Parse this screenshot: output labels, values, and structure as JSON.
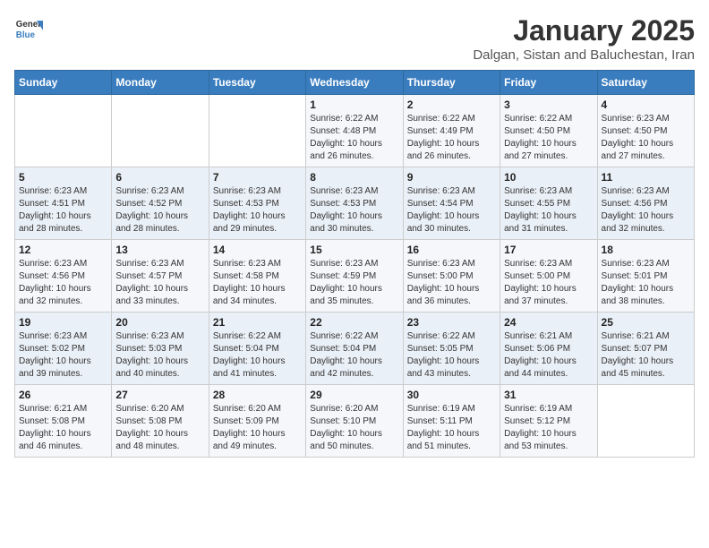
{
  "header": {
    "logo_line1": "General",
    "logo_line2": "Blue",
    "title": "January 2025",
    "subtitle": "Dalgan, Sistan and Baluchestan, Iran"
  },
  "days_of_week": [
    "Sunday",
    "Monday",
    "Tuesday",
    "Wednesday",
    "Thursday",
    "Friday",
    "Saturday"
  ],
  "weeks": [
    [
      {
        "day": "",
        "info": ""
      },
      {
        "day": "",
        "info": ""
      },
      {
        "day": "",
        "info": ""
      },
      {
        "day": "1",
        "info": "Sunrise: 6:22 AM\nSunset: 4:48 PM\nDaylight: 10 hours and 26 minutes."
      },
      {
        "day": "2",
        "info": "Sunrise: 6:22 AM\nSunset: 4:49 PM\nDaylight: 10 hours and 26 minutes."
      },
      {
        "day": "3",
        "info": "Sunrise: 6:22 AM\nSunset: 4:50 PM\nDaylight: 10 hours and 27 minutes."
      },
      {
        "day": "4",
        "info": "Sunrise: 6:23 AM\nSunset: 4:50 PM\nDaylight: 10 hours and 27 minutes."
      }
    ],
    [
      {
        "day": "5",
        "info": "Sunrise: 6:23 AM\nSunset: 4:51 PM\nDaylight: 10 hours and 28 minutes."
      },
      {
        "day": "6",
        "info": "Sunrise: 6:23 AM\nSunset: 4:52 PM\nDaylight: 10 hours and 28 minutes."
      },
      {
        "day": "7",
        "info": "Sunrise: 6:23 AM\nSunset: 4:53 PM\nDaylight: 10 hours and 29 minutes."
      },
      {
        "day": "8",
        "info": "Sunrise: 6:23 AM\nSunset: 4:53 PM\nDaylight: 10 hours and 30 minutes."
      },
      {
        "day": "9",
        "info": "Sunrise: 6:23 AM\nSunset: 4:54 PM\nDaylight: 10 hours and 30 minutes."
      },
      {
        "day": "10",
        "info": "Sunrise: 6:23 AM\nSunset: 4:55 PM\nDaylight: 10 hours and 31 minutes."
      },
      {
        "day": "11",
        "info": "Sunrise: 6:23 AM\nSunset: 4:56 PM\nDaylight: 10 hours and 32 minutes."
      }
    ],
    [
      {
        "day": "12",
        "info": "Sunrise: 6:23 AM\nSunset: 4:56 PM\nDaylight: 10 hours and 32 minutes."
      },
      {
        "day": "13",
        "info": "Sunrise: 6:23 AM\nSunset: 4:57 PM\nDaylight: 10 hours and 33 minutes."
      },
      {
        "day": "14",
        "info": "Sunrise: 6:23 AM\nSunset: 4:58 PM\nDaylight: 10 hours and 34 minutes."
      },
      {
        "day": "15",
        "info": "Sunrise: 6:23 AM\nSunset: 4:59 PM\nDaylight: 10 hours and 35 minutes."
      },
      {
        "day": "16",
        "info": "Sunrise: 6:23 AM\nSunset: 5:00 PM\nDaylight: 10 hours and 36 minutes."
      },
      {
        "day": "17",
        "info": "Sunrise: 6:23 AM\nSunset: 5:00 PM\nDaylight: 10 hours and 37 minutes."
      },
      {
        "day": "18",
        "info": "Sunrise: 6:23 AM\nSunset: 5:01 PM\nDaylight: 10 hours and 38 minutes."
      }
    ],
    [
      {
        "day": "19",
        "info": "Sunrise: 6:23 AM\nSunset: 5:02 PM\nDaylight: 10 hours and 39 minutes."
      },
      {
        "day": "20",
        "info": "Sunrise: 6:23 AM\nSunset: 5:03 PM\nDaylight: 10 hours and 40 minutes."
      },
      {
        "day": "21",
        "info": "Sunrise: 6:22 AM\nSunset: 5:04 PM\nDaylight: 10 hours and 41 minutes."
      },
      {
        "day": "22",
        "info": "Sunrise: 6:22 AM\nSunset: 5:04 PM\nDaylight: 10 hours and 42 minutes."
      },
      {
        "day": "23",
        "info": "Sunrise: 6:22 AM\nSunset: 5:05 PM\nDaylight: 10 hours and 43 minutes."
      },
      {
        "day": "24",
        "info": "Sunrise: 6:21 AM\nSunset: 5:06 PM\nDaylight: 10 hours and 44 minutes."
      },
      {
        "day": "25",
        "info": "Sunrise: 6:21 AM\nSunset: 5:07 PM\nDaylight: 10 hours and 45 minutes."
      }
    ],
    [
      {
        "day": "26",
        "info": "Sunrise: 6:21 AM\nSunset: 5:08 PM\nDaylight: 10 hours and 46 minutes."
      },
      {
        "day": "27",
        "info": "Sunrise: 6:20 AM\nSunset: 5:08 PM\nDaylight: 10 hours and 48 minutes."
      },
      {
        "day": "28",
        "info": "Sunrise: 6:20 AM\nSunset: 5:09 PM\nDaylight: 10 hours and 49 minutes."
      },
      {
        "day": "29",
        "info": "Sunrise: 6:20 AM\nSunset: 5:10 PM\nDaylight: 10 hours and 50 minutes."
      },
      {
        "day": "30",
        "info": "Sunrise: 6:19 AM\nSunset: 5:11 PM\nDaylight: 10 hours and 51 minutes."
      },
      {
        "day": "31",
        "info": "Sunrise: 6:19 AM\nSunset: 5:12 PM\nDaylight: 10 hours and 53 minutes."
      },
      {
        "day": "",
        "info": ""
      }
    ]
  ]
}
